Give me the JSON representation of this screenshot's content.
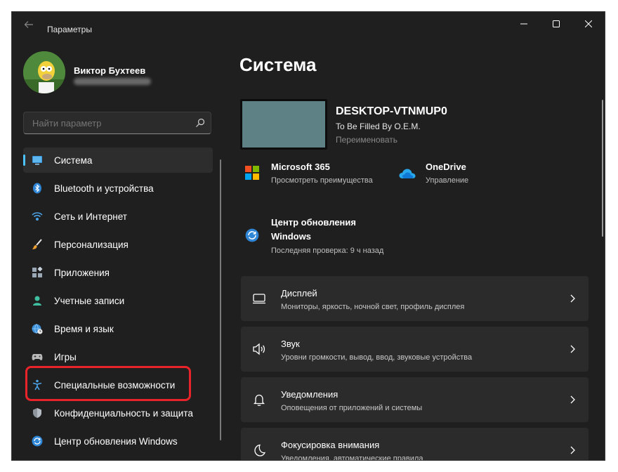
{
  "window": {
    "title": "Параметры"
  },
  "user": {
    "name": "Виктор Бухтеев"
  },
  "search": {
    "placeholder": "Найти параметр"
  },
  "nav": {
    "items": [
      {
        "label": "Система",
        "icon": "monitor-icon",
        "active": true
      },
      {
        "label": "Bluetooth и устройства",
        "icon": "bluetooth-icon"
      },
      {
        "label": "Сеть и Интернет",
        "icon": "wifi-icon"
      },
      {
        "label": "Персонализация",
        "icon": "brush-icon"
      },
      {
        "label": "Приложения",
        "icon": "apps-icon"
      },
      {
        "label": "Учетные записи",
        "icon": "person-icon"
      },
      {
        "label": "Время и язык",
        "icon": "globe-clock-icon"
      },
      {
        "label": "Игры",
        "icon": "gamepad-icon"
      },
      {
        "label": "Специальные возможности",
        "icon": "accessibility-icon",
        "highlighted": true
      },
      {
        "label": "Конфиденциальность и защита",
        "icon": "shield-icon"
      },
      {
        "label": "Центр обновления Windows",
        "icon": "update-icon"
      }
    ]
  },
  "main": {
    "title": "Система",
    "device": {
      "name": "DESKTOP-VTNMUP0",
      "model": "To Be Filled By O.E.M.",
      "rename": "Переименовать"
    },
    "tiles": {
      "ms365": {
        "title": "Microsoft 365",
        "sub": "Просмотреть преимущества"
      },
      "onedrive": {
        "title": "OneDrive",
        "sub": "Управление"
      },
      "update": {
        "title_line1": "Центр обновления",
        "title_line2": "Windows",
        "sub": "Последняя проверка: 9 ч назад"
      }
    },
    "cards": [
      {
        "title": "Дисплей",
        "sub": "Мониторы, яркость, ночной свет, профиль дисплея",
        "icon": "display-icon"
      },
      {
        "title": "Звук",
        "sub": "Уровни громкости, вывод, ввод, звуковые устройства",
        "icon": "speaker-icon"
      },
      {
        "title": "Уведомления",
        "sub": "Оповещения от приложений и системы",
        "icon": "bell-icon"
      },
      {
        "title": "Фокусировка внимания",
        "sub": "Уведомления, автоматические правила",
        "icon": "moon-icon"
      }
    ]
  },
  "colors": {
    "accent": "#4cc2ff",
    "highlight": "#e8242a",
    "background": "#1f1f1f",
    "card": "#2b2b2b"
  }
}
